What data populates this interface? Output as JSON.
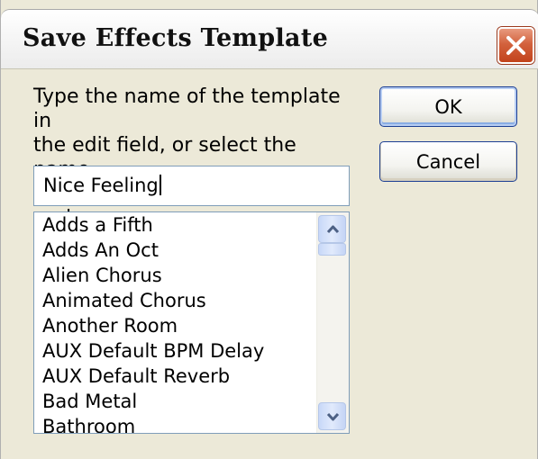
{
  "window": {
    "title": "Save Effects Template",
    "close_icon": "close-icon"
  },
  "instructions": "Type the name of the template in\nthe edit field, or select the name\nof an existing template to replace.",
  "buttons": {
    "ok_label": "OK",
    "cancel_label": "Cancel"
  },
  "name_input": {
    "value": "Nice Feeling"
  },
  "template_list": {
    "items": [
      "Adds a Fifth",
      "Adds An Oct",
      "Alien Chorus",
      "Animated Chorus",
      "Another Room",
      "AUX Default BPM Delay",
      "AUX Default Reverb",
      "Bad Metal",
      "Bathroom"
    ],
    "scroll_up_icon": "chevron-up-icon",
    "scroll_down_icon": "chevron-down-icon"
  },
  "colors": {
    "dialog_bg": "#ece9d8",
    "close_button": "#c2431c",
    "input_border": "#7f9db9",
    "button_border": "#1c3f94"
  }
}
